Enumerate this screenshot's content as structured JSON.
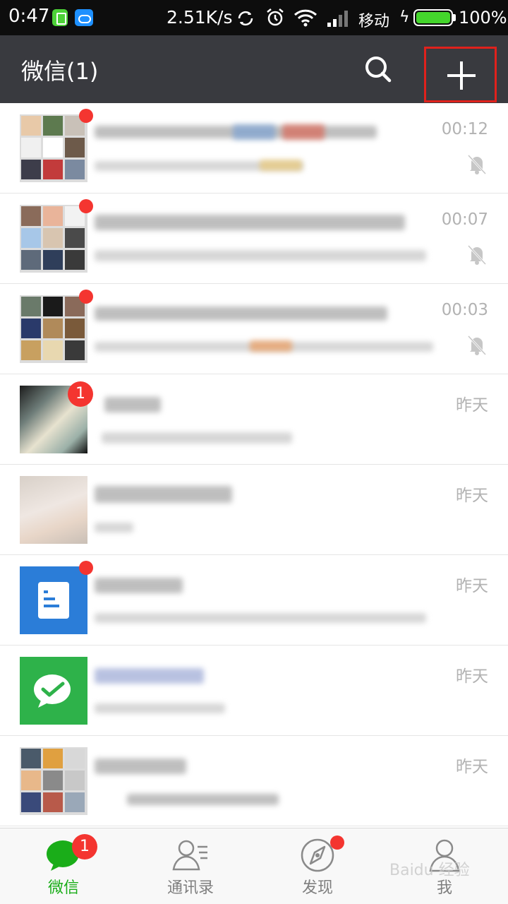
{
  "status_bar": {
    "time": "0:47",
    "net_speed": "2.51K/s",
    "carrier": "移动",
    "battery_percent": "100%",
    "battery_level": 1.0,
    "icons": [
      "phone-app-icon",
      "cloud-app-icon",
      "sync-icon",
      "alarm-icon",
      "wifi-icon",
      "signal-icon",
      "charging-icon",
      "battery-icon"
    ]
  },
  "header": {
    "title": "微信(1)",
    "search_icon": "search-icon",
    "add_icon": "plus-icon",
    "highlight_color": "#e0211c"
  },
  "chats": [
    {
      "time": "00:12",
      "muted": true,
      "indicator": "dot",
      "avatar": "group-grid"
    },
    {
      "time": "00:07",
      "muted": true,
      "indicator": "dot",
      "avatar": "group-grid"
    },
    {
      "time": "00:03",
      "muted": true,
      "indicator": "dot",
      "avatar": "group-grid"
    },
    {
      "time": "昨天",
      "muted": false,
      "indicator": "badge",
      "badge": "1",
      "avatar": "photo"
    },
    {
      "time": "昨天",
      "muted": false,
      "indicator": "none",
      "avatar": "photo"
    },
    {
      "time": "昨天",
      "muted": false,
      "indicator": "dot",
      "avatar": "document-app"
    },
    {
      "time": "昨天",
      "muted": false,
      "indicator": "none",
      "avatar": "wechat-pay"
    },
    {
      "time": "昨天",
      "muted": false,
      "indicator": "none",
      "avatar": "group-grid"
    }
  ],
  "bottom_nav": {
    "items": [
      {
        "label": "微信",
        "icon": "chat-bubble-icon",
        "active": true,
        "badge": "1"
      },
      {
        "label": "通讯录",
        "icon": "contacts-icon",
        "active": false
      },
      {
        "label": "发现",
        "icon": "compass-icon",
        "active": false,
        "dot": true
      },
      {
        "label": "我",
        "icon": "person-icon",
        "active": false
      }
    ]
  },
  "watermark": "Baidu 经验",
  "colors": {
    "accent_green": "#1aad19",
    "badge_red": "#f43530",
    "title_bar": "#393a3f"
  }
}
